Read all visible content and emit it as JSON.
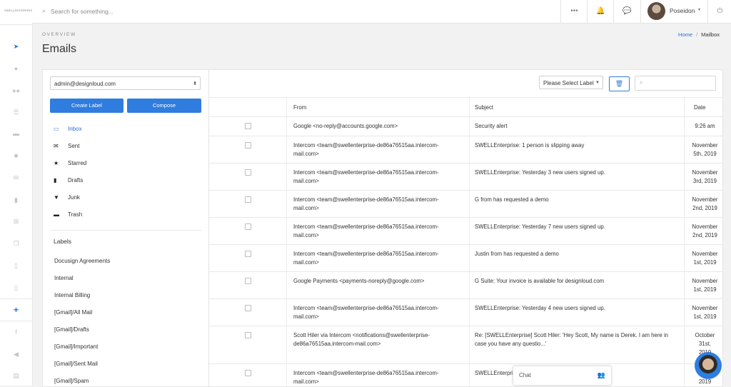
{
  "rail": {
    "logo": "SWELLENTERPRISE",
    "icons": [
      "paper-plane-icon",
      "user-icon",
      "users-icon",
      "list-icon",
      "folder-icon",
      "check-square-icon",
      "mail-icon",
      "clipboard-icon",
      "sitemap-icon",
      "copy-icon",
      "file-icon",
      "file-alt-icon"
    ],
    "plus": "+",
    "social": [
      "facebook-icon",
      "bullhorn-icon",
      "database-icon"
    ]
  },
  "topbar": {
    "search_placeholder": "Search for something...",
    "more": "•••",
    "bell": "🔔",
    "chat": "💬",
    "username": "Poseidon",
    "caret": "▾",
    "power": "⏻"
  },
  "page": {
    "overview": "OVERVIEW",
    "title": "Emails",
    "breadcrumb": {
      "home": "Home",
      "sep": "/",
      "current": "Mailbox"
    }
  },
  "sidebar": {
    "account": "admin@designloud.com",
    "create_label": "Create Label",
    "compose": "Compose",
    "folders": [
      {
        "icon": "inbox-icon",
        "glyph": "▭",
        "label": "Inbox",
        "active": true
      },
      {
        "icon": "envelope-icon",
        "glyph": "✉",
        "label": "Sent"
      },
      {
        "icon": "star-icon",
        "glyph": "★",
        "label": "Starred"
      },
      {
        "icon": "file-icon",
        "glyph": "▮",
        "label": "Drafts"
      },
      {
        "icon": "filter-icon",
        "glyph": "▼",
        "label": "Junk"
      },
      {
        "icon": "trash-icon",
        "glyph": "▬",
        "label": "Trash"
      }
    ],
    "labels_title": "Labels",
    "labels": [
      "Docusign Agreements",
      "Internal",
      "Internal Billing",
      "[Gmail]/All Mail",
      "[Gmail]/Drafts",
      "[Gmail]/Important",
      "[Gmail]/Sent Mail",
      "[Gmail]/Spam"
    ]
  },
  "toolbar": {
    "label_select": "Please Select Label",
    "trash": "🗑",
    "search_icon": "⌕"
  },
  "table": {
    "headers": {
      "from": "From",
      "subject": "Subject",
      "date": "Date"
    },
    "rows": [
      {
        "from": [
          "Google <no-reply@accounts.google.com>"
        ],
        "subject": [
          "Security alert"
        ],
        "date": [
          "9:26 am"
        ]
      },
      {
        "from": [
          "Intercom <team@swellenterprise-de86a76515aa.intercom-",
          "mail.com>"
        ],
        "subject": [
          "SWELLEnterprise: 1 person is slipping away"
        ],
        "date": [
          "November",
          "5th, 2019"
        ]
      },
      {
        "from": [
          "Intercom <team@swellenterprise-de86a76515aa.intercom-",
          "mail.com>"
        ],
        "subject": [
          "SWELLEnterprise: Yesterday 3 new users signed up."
        ],
        "date": [
          "November",
          "3rd, 2019"
        ]
      },
      {
        "from": [
          "Intercom <team@swellenterprise-de86a76515aa.intercom-",
          "mail.com>"
        ],
        "subject": [
          "G from has requested a demo"
        ],
        "date": [
          "November",
          "2nd, 2019"
        ]
      },
      {
        "from": [
          "Intercom <team@swellenterprise-de86a76515aa.intercom-",
          "mail.com>"
        ],
        "subject": [
          "SWELLEnterprise: Yesterday 7 new users signed up."
        ],
        "date": [
          "November",
          "2nd, 2019"
        ]
      },
      {
        "from": [
          "Intercom <team@swellenterprise-de86a76515aa.intercom-",
          "mail.com>"
        ],
        "subject": [
          "Justin from has requested a demo"
        ],
        "date": [
          "November",
          "1st, 2019"
        ]
      },
      {
        "from": [
          "Google Payments <payments-noreply@google.com>"
        ],
        "subject": [
          "G Suite: Your invoice is available for designloud.com"
        ],
        "date": [
          "November",
          "1st, 2019"
        ]
      },
      {
        "from": [
          "Intercom <team@swellenterprise-de86a76515aa.intercom-",
          "mail.com>"
        ],
        "subject": [
          "SWELLEnterprise: Yesterday 4 new users signed up."
        ],
        "date": [
          "November",
          "1st, 2019"
        ]
      },
      {
        "from": [
          "Scott Hiler via Intercom <notifications@swellenterprise-",
          "de86a76515aa.intercom-mail.com>"
        ],
        "subject": [
          "Re: [SWELLEnterprise] Scott Hiler: 'Hey Scott, My name is Derek. I am here in",
          "case you have any questio...'"
        ],
        "date": [
          "October",
          "31st,",
          "2019"
        ]
      },
      {
        "from": [
          "Intercom <team@swellenterprise-de86a76515aa.intercom-",
          "mail.com>"
        ],
        "subject": [
          "SWELLEnterprise: Yesterday 4 new users signed up."
        ],
        "date": [
          "O",
          "2019"
        ]
      }
    ]
  },
  "chat": {
    "label": "Chat",
    "icon": "👥"
  }
}
